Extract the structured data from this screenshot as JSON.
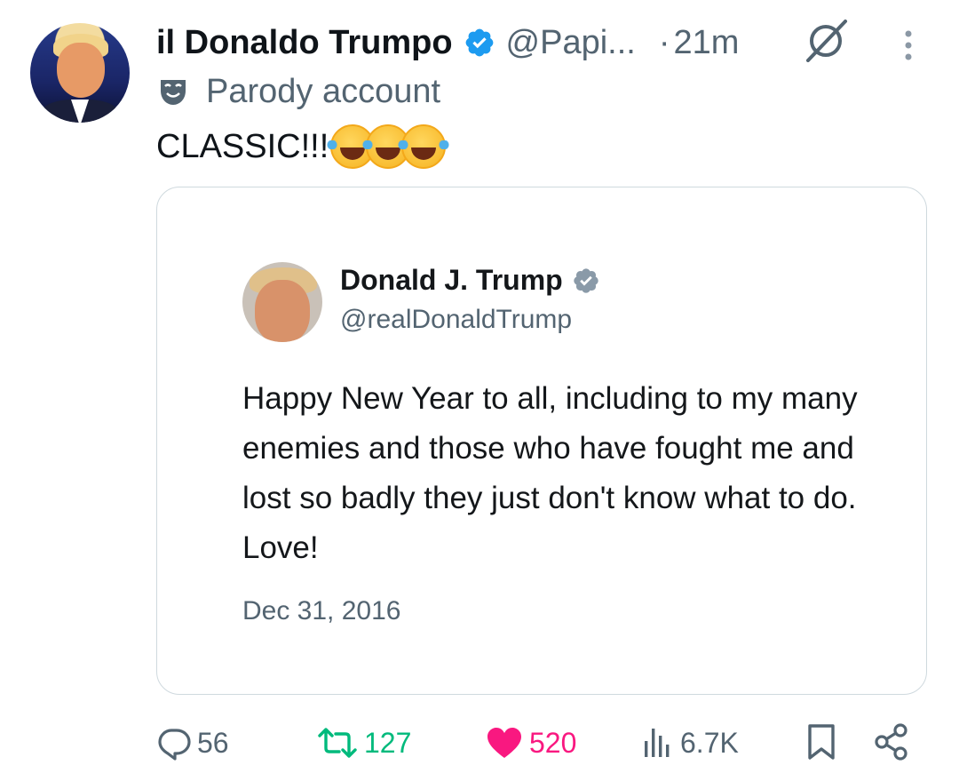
{
  "post": {
    "author_name": "il Donaldo Trumpo",
    "handle": "@Papi...",
    "separator": "·",
    "time": "21m",
    "label": "Parody account",
    "text": "CLASSIC!!!",
    "emoji": [
      "😂",
      "😂",
      "😂"
    ]
  },
  "quoted": {
    "author_name": "Donald J. Trump",
    "handle": "@realDonaldTrump",
    "text": "Happy New Year to all, including to my many enemies and those who have fought me and lost so badly they just don't know what to do. Love!",
    "date": "Dec 31, 2016"
  },
  "actions": {
    "replies": "56",
    "reposts": "127",
    "likes": "520",
    "views": "6.7K"
  },
  "colors": {
    "verified": "#1d9bf0",
    "muted": "#536471",
    "repost": "#00ba7c",
    "like": "#f91880",
    "border": "#cfd9de"
  },
  "icons": [
    "verified-badge-icon",
    "grok-icon",
    "more-icon",
    "parody-mask-icon",
    "reply-icon",
    "repost-icon",
    "heart-icon",
    "views-icon",
    "bookmark-icon",
    "share-icon"
  ]
}
